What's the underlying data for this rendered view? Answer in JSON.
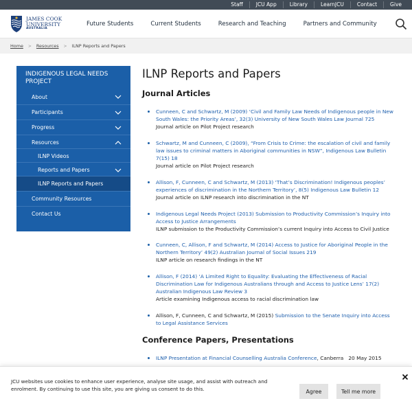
{
  "utility_nav": [
    "Staff",
    "JCU App",
    "Library",
    "LearnJCU",
    "Contact",
    "Give"
  ],
  "logo": {
    "line1": "JAMES COOK",
    "line2": "UNIVERSITY",
    "line3": "AUSTRALIA"
  },
  "main_nav": [
    "Future Students",
    "Current Students",
    "Research and Teaching",
    "Partners and Community"
  ],
  "breadcrumb": {
    "home": "Home",
    "resources": "Resources",
    "current": "ILNP Reports and Papers"
  },
  "sidenav": {
    "title": "INDIGENOUS LEGAL NEEDS PROJECT",
    "items": [
      {
        "label": "About"
      },
      {
        "label": "Participants"
      },
      {
        "label": "Progress"
      },
      {
        "label": "Resources"
      },
      {
        "label": "ILNP Videos"
      },
      {
        "label": "Reports and Papers"
      },
      {
        "label": "ILNP Reports and Papers"
      },
      {
        "label": "Community Resources"
      },
      {
        "label": "Contact Us"
      }
    ]
  },
  "page_title": "ILNP Reports and Papers",
  "journal_heading": "Journal Articles",
  "articles": [
    {
      "pre": "",
      "link": "Cunneen, C and Schwartz, M (2009) ‘Civil and Family Law Needs of Indigenous people in New South Wales: the Priority Areas’, 32(3) University of New South Wales Law Journal 725",
      "desc": "Journal article on Pilot Project research"
    },
    {
      "pre": "",
      "link": "Schwartz, M and Cunneen, C (2009), “From Crisis to Crime: the escalation of civil and family law issues to criminal matters in Aboriginal communities in NSW”, Indigenous Law Bulletin 7(15) 18",
      "desc": "Journal article on Pilot Project research"
    },
    {
      "pre": "",
      "link": "Allison, F, Cunneen, C and Schwartz, M (2013) ‘That’s Discrimination! Indigenous peoples’ experiences of discrimination in the Northern Territory’, 8(5) Indigenous Law Bulletin 12",
      "desc": "Journal article on ILNP research into discrimination in the NT"
    },
    {
      "pre": "",
      "link": "Indigenous Legal Needs Project (2013) Submission to Productivity Commission’s Inquiry into Access to Justice Arrangements",
      "desc": "ILNP submission to the Productivity Commission’s current Inquiry into Access to Civil Justice"
    },
    {
      "pre": "",
      "link": "Cunneen, C, Allison, F and Schwartz, M (2014) Access to Justice for Aboriginal People in the Northern Territory’ 49(2) Australian Journal of Social Issues 219",
      "desc": "ILNP article on research findings in the NT"
    },
    {
      "pre": "",
      "link": "Allison, F (2014) ‘A Limited Right to Equality: Evaluating the Effectiveness of Racial Discrimination Law for Indigenous Australians through and Access to Justice Lens’ 17(2) Australian Indigenous Law Review 3",
      "desc": "Article examining Indigenous access to racial discrimination law"
    },
    {
      "pre": "Allison, F, Cunneen, C and Schwartz, M (2015) ",
      "link": "Submission to the Senate Inquiry into Access to Legal Assistance Services",
      "desc": ""
    }
  ],
  "conference_heading": "Conference Papers, Presentations",
  "conference_items": [
    {
      "link": "ILNP Presentation at Financial Counselling Australia Conference",
      "rest": ", Canberra   20 May 2015"
    }
  ],
  "cookie": {
    "text": "JCU websites use cookies to enhance user experience, analyse site usage, and assist with outreach and enrolment. By continuing to use this site, you are giving us consent to do this.",
    "agree": "Agree",
    "more": "Tell me more"
  },
  "colors": {
    "nav_blue": "#1b5fa8",
    "link": "#1e5fad",
    "utility_bg": "#414b56"
  }
}
